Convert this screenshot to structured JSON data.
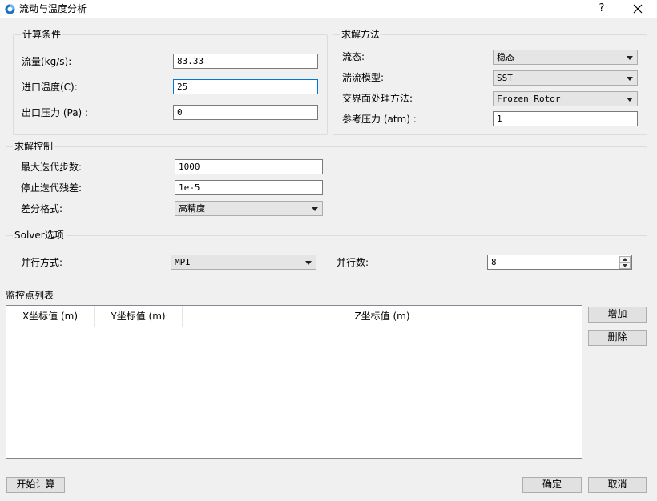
{
  "window": {
    "title": "流动与温度分析",
    "help_label": "?",
    "close_label": "✕"
  },
  "calc_conditions": {
    "title": "计算条件",
    "flow_label": "流量(kg/s):",
    "flow_value": "83.33",
    "inlet_temp_label": "进口温度(C):",
    "inlet_temp_value": "25",
    "outlet_pressure_label": "出口压力 (Pa) :",
    "outlet_pressure_value": "0"
  },
  "solve_method": {
    "title": "求解方法",
    "flow_state_label": "流态:",
    "flow_state_value": "稳态",
    "turbulence_label": "湍流模型:",
    "turbulence_value": "SST",
    "interface_label": "交界面处理方法:",
    "interface_value": "Frozen Rotor",
    "ref_pressure_label": "参考压力 (atm) :",
    "ref_pressure_value": "1"
  },
  "solve_control": {
    "title": "求解控制",
    "max_iter_label": "最大迭代步数:",
    "max_iter_value": "1000",
    "stop_residual_label": "停止迭代残差:",
    "stop_residual_value": "1e-5",
    "scheme_label": "差分格式:",
    "scheme_value": "高精度"
  },
  "solver_options": {
    "title": "Solver选项",
    "parallel_mode_label": "并行方式:",
    "parallel_mode_value": "MPI",
    "parallel_count_label": "并行数:",
    "parallel_count_value": "8"
  },
  "monitor": {
    "title": "监控点列表",
    "columns": [
      "X坐标值 (m)",
      "Y坐标值 (m)",
      "Z坐标值 (m)"
    ],
    "add_label": "增加",
    "delete_label": "删除"
  },
  "footer": {
    "start_label": "开始计算",
    "ok_label": "确定",
    "cancel_label": "取消"
  },
  "colors": {
    "accent": "#0078d7",
    "icon": "#1e73be"
  }
}
